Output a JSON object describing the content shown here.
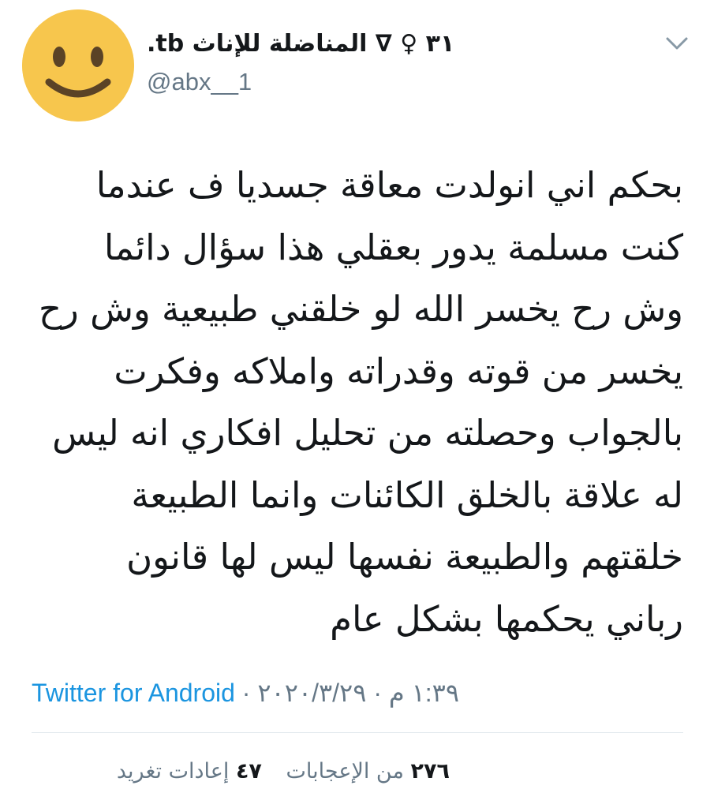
{
  "author": {
    "display_name_ltr": ".tb ٣١ ♀︎ ∇ المناضلة للإناث",
    "handle": "@abx__1",
    "avatar_icon": "smiling-face-emoji",
    "avatar_color": "#f7c64d"
  },
  "tweet": {
    "lines": [
      "بحكم اني انولدت معاقة جسديا ف عندما",
      "كنت مسلمة يدور بعقلي هذا سؤال دائما",
      "وش رح يخسر الله لو خلقني طبيعية وش رح",
      "يخسر من قوته وقدراته واملاكه وفكرت",
      "بالجواب وحصلته من تحليل افكاري انه ليس",
      "له علاقة بالخلق الكائنات وانما الطبيعة",
      "خلقتهم والطبيعة نفسها ليس لها قانون",
      "رباني يحكمها بشكل عام"
    ]
  },
  "meta": {
    "source": "Twitter for Android",
    "separator": "·",
    "date": "٢٠٢٠/٣/٢٩",
    "time": "١:٣٩ م",
    "source_color": "#1b95e0"
  },
  "stats": {
    "likes_count": "٢٧٦",
    "likes_label": "من الإعجابات",
    "retweets_count": "٤٧",
    "retweets_label": "إعادات تغريد"
  },
  "icons": {
    "more": "chevron-down-icon"
  },
  "colors": {
    "text": "#14171a",
    "secondary": "#657786",
    "divider": "#e1e8ed"
  }
}
